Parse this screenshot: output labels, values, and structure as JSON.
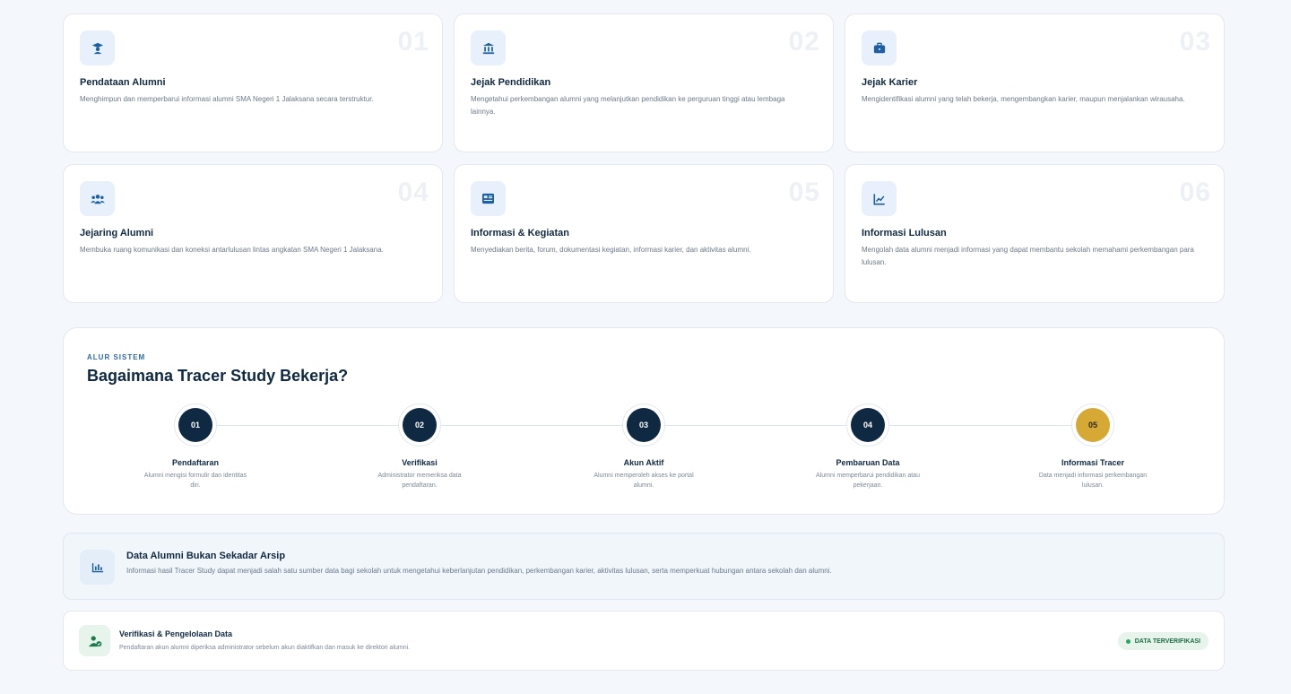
{
  "features": [
    {
      "num": "01",
      "title": "Pendataan Alumni",
      "desc": "Menghimpun dan memperbarui informasi alumni SMA Negeri 1 Jalaksana secara terstruktur.",
      "icon": "graduate-icon"
    },
    {
      "num": "02",
      "title": "Jejak Pendidikan",
      "desc": "Mengetahui perkembangan alumni yang melanjutkan pendidikan ke perguruan tinggi atau lembaga lainnya.",
      "icon": "university-icon"
    },
    {
      "num": "03",
      "title": "Jejak Karier",
      "desc": "Mengidentifikasi alumni yang telah bekerja, mengembangkan karier, maupun menjalankan wirausaha.",
      "icon": "briefcase-icon"
    },
    {
      "num": "04",
      "title": "Jejaring Alumni",
      "desc": "Membuka ruang komunikasi dan koneksi antarlulusan lintas angkatan SMA Negeri 1 Jalaksana.",
      "icon": "users-icon"
    },
    {
      "num": "05",
      "title": "Informasi & Kegiatan",
      "desc": "Menyediakan berita, forum, dokumentasi kegiatan, informasi karier, dan aktivitas alumni.",
      "icon": "newspaper-icon"
    },
    {
      "num": "06",
      "title": "Informasi Lulusan",
      "desc": "Mengolah data alumni menjadi informasi yang dapat membantu sekolah memahami perkembangan para lulusan.",
      "icon": "chart-line-icon"
    }
  ],
  "flow": {
    "eyebrow": "ALUR SISTEM",
    "heading": "Bagaimana Tracer Study Bekerja?",
    "steps": [
      {
        "num": "01",
        "title": "Pendaftaran",
        "desc": "Alumni mengisi formulir dan identitas diri."
      },
      {
        "num": "02",
        "title": "Verifikasi",
        "desc": "Administrator memeriksa data pendaftaran."
      },
      {
        "num": "03",
        "title": "Akun Aktif",
        "desc": "Alumni memperoleh akses ke portal alumni."
      },
      {
        "num": "04",
        "title": "Pembaruan Data",
        "desc": "Alumni memperbarui pendidikan atau pekerjaan."
      },
      {
        "num": "05",
        "title": "Informasi Tracer",
        "desc": "Data menjadi informasi perkembangan lulusan."
      }
    ]
  },
  "banner": {
    "title": "Data Alumni Bukan Sekadar Arsip",
    "desc": "Informasi hasil Tracer Study dapat menjadi salah satu sumber data bagi sekolah untuk mengetahui keberlanjutan pendidikan, perkembangan karier, aktivitas lulusan, serta memperkuat hubungan antara sekolah dan alumni.",
    "icon": "bar-chart-icon"
  },
  "verify": {
    "title": "Verifikasi & Pengelolaan Data",
    "desc": "Pendaftaran akun alumni diperiksa administrator sebelum akun diaktifkan dan masuk ke direktori alumni.",
    "badge": "DATA TERVERIFIKASI",
    "icon": "user-check-icon"
  },
  "colors": {
    "primary": "#0f2942",
    "accent": "#2a6bb0",
    "gold": "#d6a935",
    "success": "#27a862"
  }
}
